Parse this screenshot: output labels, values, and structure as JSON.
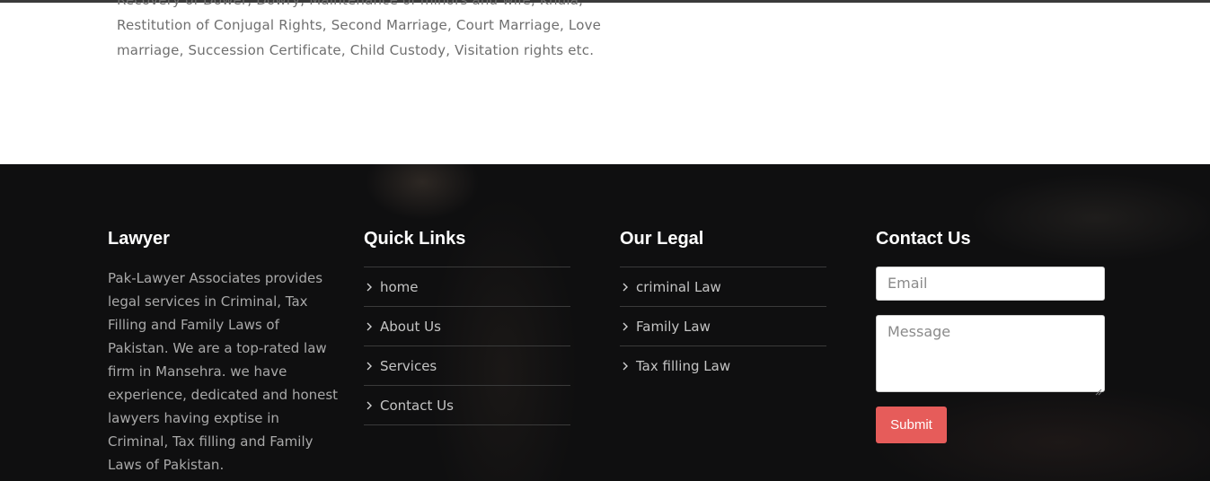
{
  "intro": {
    "line_cut": "Recovery of Dower, Dowry, Maintenance of minors and wife, Khula,",
    "text": "Restitution of Conjugal Rights, Second Marriage, Court Marriage, Love marriage, Succession Certificate, Child Custody, Visitation rights etc."
  },
  "footer": {
    "about": {
      "title": "Lawyer",
      "text": "Pak-Lawyer Associates provides legal services in Criminal, Tax Filling and Family Laws of Pakistan. We are a top-rated law firm in Mansehra. we have experience, dedicated and honest lawyers having exptise in Criminal, Tax filling and Family Laws of Pakistan."
    },
    "quick_links": {
      "title": "Quick Links",
      "items": [
        "home",
        "About Us",
        "Services",
        "Contact Us"
      ]
    },
    "legal": {
      "title": "Our Legal",
      "items": [
        "criminal Law",
        "Family Law",
        "Tax filling Law"
      ]
    },
    "contact": {
      "title": "Contact Us",
      "email_placeholder": "Email",
      "message_placeholder": "Message",
      "submit_label": "Submit"
    }
  },
  "colors": {
    "footer_bg": "#0f0f10",
    "accent": "#e65c5a"
  }
}
